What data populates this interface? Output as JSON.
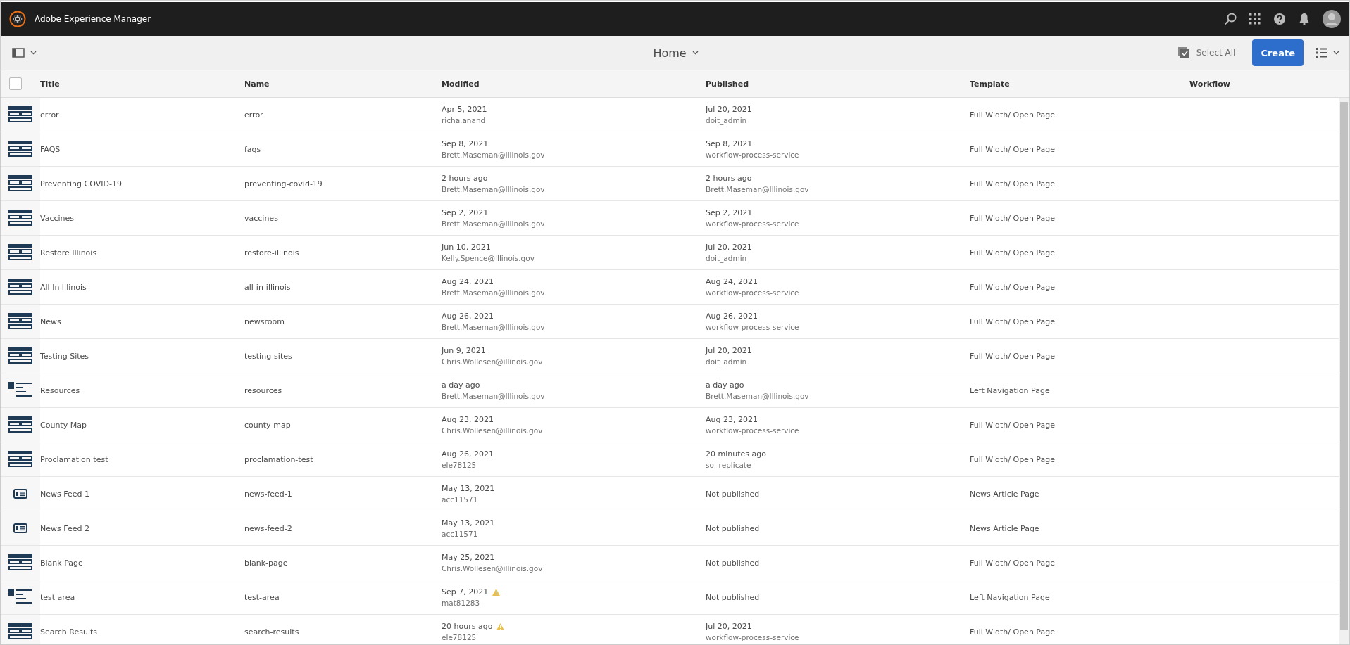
{
  "app_bar": {
    "title": "Adobe Experience Manager"
  },
  "toolbar": {
    "location": "Home",
    "select_all": "Select All",
    "create": "Create"
  },
  "table": {
    "select_all_checked": false,
    "columns": [
      "Title",
      "Name",
      "Modified",
      "Published",
      "Template",
      "Workflow"
    ],
    "rows": [
      {
        "kind": "full-width",
        "title": "error",
        "name": "error",
        "modified": {
          "date": "Apr 5, 2021",
          "by": "richa.anand",
          "warning": false
        },
        "published": {
          "date": "Jul 20, 2021",
          "by": "doit_admin"
        },
        "template": "Full Width/ Open Page"
      },
      {
        "kind": "full-width",
        "title": "FAQS",
        "name": "faqs",
        "modified": {
          "date": "Sep 8, 2021",
          "by": "Brett.Maseman@Illinois.gov",
          "warning": false
        },
        "published": {
          "date": "Sep 8, 2021",
          "by": "workflow-process-service"
        },
        "template": "Full Width/ Open Page"
      },
      {
        "kind": "full-width",
        "title": "Preventing COVID-19",
        "name": "preventing-covid-19",
        "modified": {
          "date": "2 hours ago",
          "by": "Brett.Maseman@Illinois.gov",
          "warning": false
        },
        "published": {
          "date": "2 hours ago",
          "by": "Brett.Maseman@Illinois.gov"
        },
        "template": "Full Width/ Open Page"
      },
      {
        "kind": "full-width",
        "title": "Vaccines",
        "name": "vaccines",
        "modified": {
          "date": "Sep 2, 2021",
          "by": "Brett.Maseman@Illinois.gov",
          "warning": false
        },
        "published": {
          "date": "Sep 2, 2021",
          "by": "workflow-process-service"
        },
        "template": "Full Width/ Open Page"
      },
      {
        "kind": "full-width",
        "title": "Restore Illinois",
        "name": "restore-illinois",
        "modified": {
          "date": "Jun 10, 2021",
          "by": "Kelly.Spence@Illinois.gov",
          "warning": false
        },
        "published": {
          "date": "Jul 20, 2021",
          "by": "doit_admin"
        },
        "template": "Full Width/ Open Page"
      },
      {
        "kind": "full-width",
        "title": "All In Illinois",
        "name": "all-in-illinois",
        "modified": {
          "date": "Aug 24, 2021",
          "by": "Brett.Maseman@Illinois.gov",
          "warning": false
        },
        "published": {
          "date": "Aug 24, 2021",
          "by": "workflow-process-service"
        },
        "template": "Full Width/ Open Page"
      },
      {
        "kind": "full-width",
        "title": "News",
        "name": "newsroom",
        "modified": {
          "date": "Aug 26, 2021",
          "by": "Brett.Maseman@Illinois.gov",
          "warning": false
        },
        "published": {
          "date": "Aug 26, 2021",
          "by": "workflow-process-service"
        },
        "template": "Full Width/ Open Page"
      },
      {
        "kind": "full-width",
        "title": "Testing Sites",
        "name": "testing-sites",
        "modified": {
          "date": "Jun 9, 2021",
          "by": "Chris.Wollesen@illinois.gov",
          "warning": false
        },
        "published": {
          "date": "Jul 20, 2021",
          "by": "doit_admin"
        },
        "template": "Full Width/ Open Page"
      },
      {
        "kind": "left-nav",
        "title": "Resources",
        "name": "resources",
        "modified": {
          "date": "a day ago",
          "by": "Brett.Maseman@Illinois.gov",
          "warning": false
        },
        "published": {
          "date": "a day ago",
          "by": "Brett.Maseman@Illinois.gov"
        },
        "template": "Left Navigation Page"
      },
      {
        "kind": "full-width",
        "title": "County Map",
        "name": "county-map",
        "modified": {
          "date": "Aug 23, 2021",
          "by": "Chris.Wollesen@illinois.gov",
          "warning": false
        },
        "published": {
          "date": "Aug 23, 2021",
          "by": "workflow-process-service"
        },
        "template": "Full Width/ Open Page"
      },
      {
        "kind": "full-width",
        "title": "Proclamation test",
        "name": "proclamation-test",
        "modified": {
          "date": "Aug 26, 2021",
          "by": "ele78125",
          "warning": false
        },
        "published": {
          "date": "20 minutes ago",
          "by": "soi-replicate"
        },
        "template": "Full Width/ Open Page"
      },
      {
        "kind": "news",
        "title": "News Feed 1",
        "name": "news-feed-1",
        "modified": {
          "date": "May 13, 2021",
          "by": "acc11571",
          "warning": false
        },
        "published": {
          "date": "Not published"
        },
        "template": "News Article Page"
      },
      {
        "kind": "news",
        "title": "News Feed 2",
        "name": "news-feed-2",
        "modified": {
          "date": "May 13, 2021",
          "by": "acc11571",
          "warning": false
        },
        "published": {
          "date": "Not published"
        },
        "template": "News Article Page"
      },
      {
        "kind": "full-width",
        "title": "Blank Page",
        "name": "blank-page",
        "modified": {
          "date": "May 25, 2021",
          "by": "Chris.Wollesen@illinois.gov",
          "warning": false
        },
        "published": {
          "date": "Not published"
        },
        "template": "Full Width/ Open Page"
      },
      {
        "kind": "left-nav",
        "title": "test area",
        "name": "test-area",
        "modified": {
          "date": "Sep 7, 2021",
          "by": "mat81283",
          "warning": true
        },
        "published": {
          "date": "Not published"
        },
        "template": "Left Navigation Page"
      },
      {
        "kind": "full-width",
        "title": "Search Results",
        "name": "search-results",
        "modified": {
          "date": "20 hours ago",
          "by": "ele78125",
          "warning": true
        },
        "published": {
          "date": "Jul 20, 2021",
          "by": "workflow-process-service"
        },
        "template": "Full Width/ Open Page"
      }
    ]
  }
}
